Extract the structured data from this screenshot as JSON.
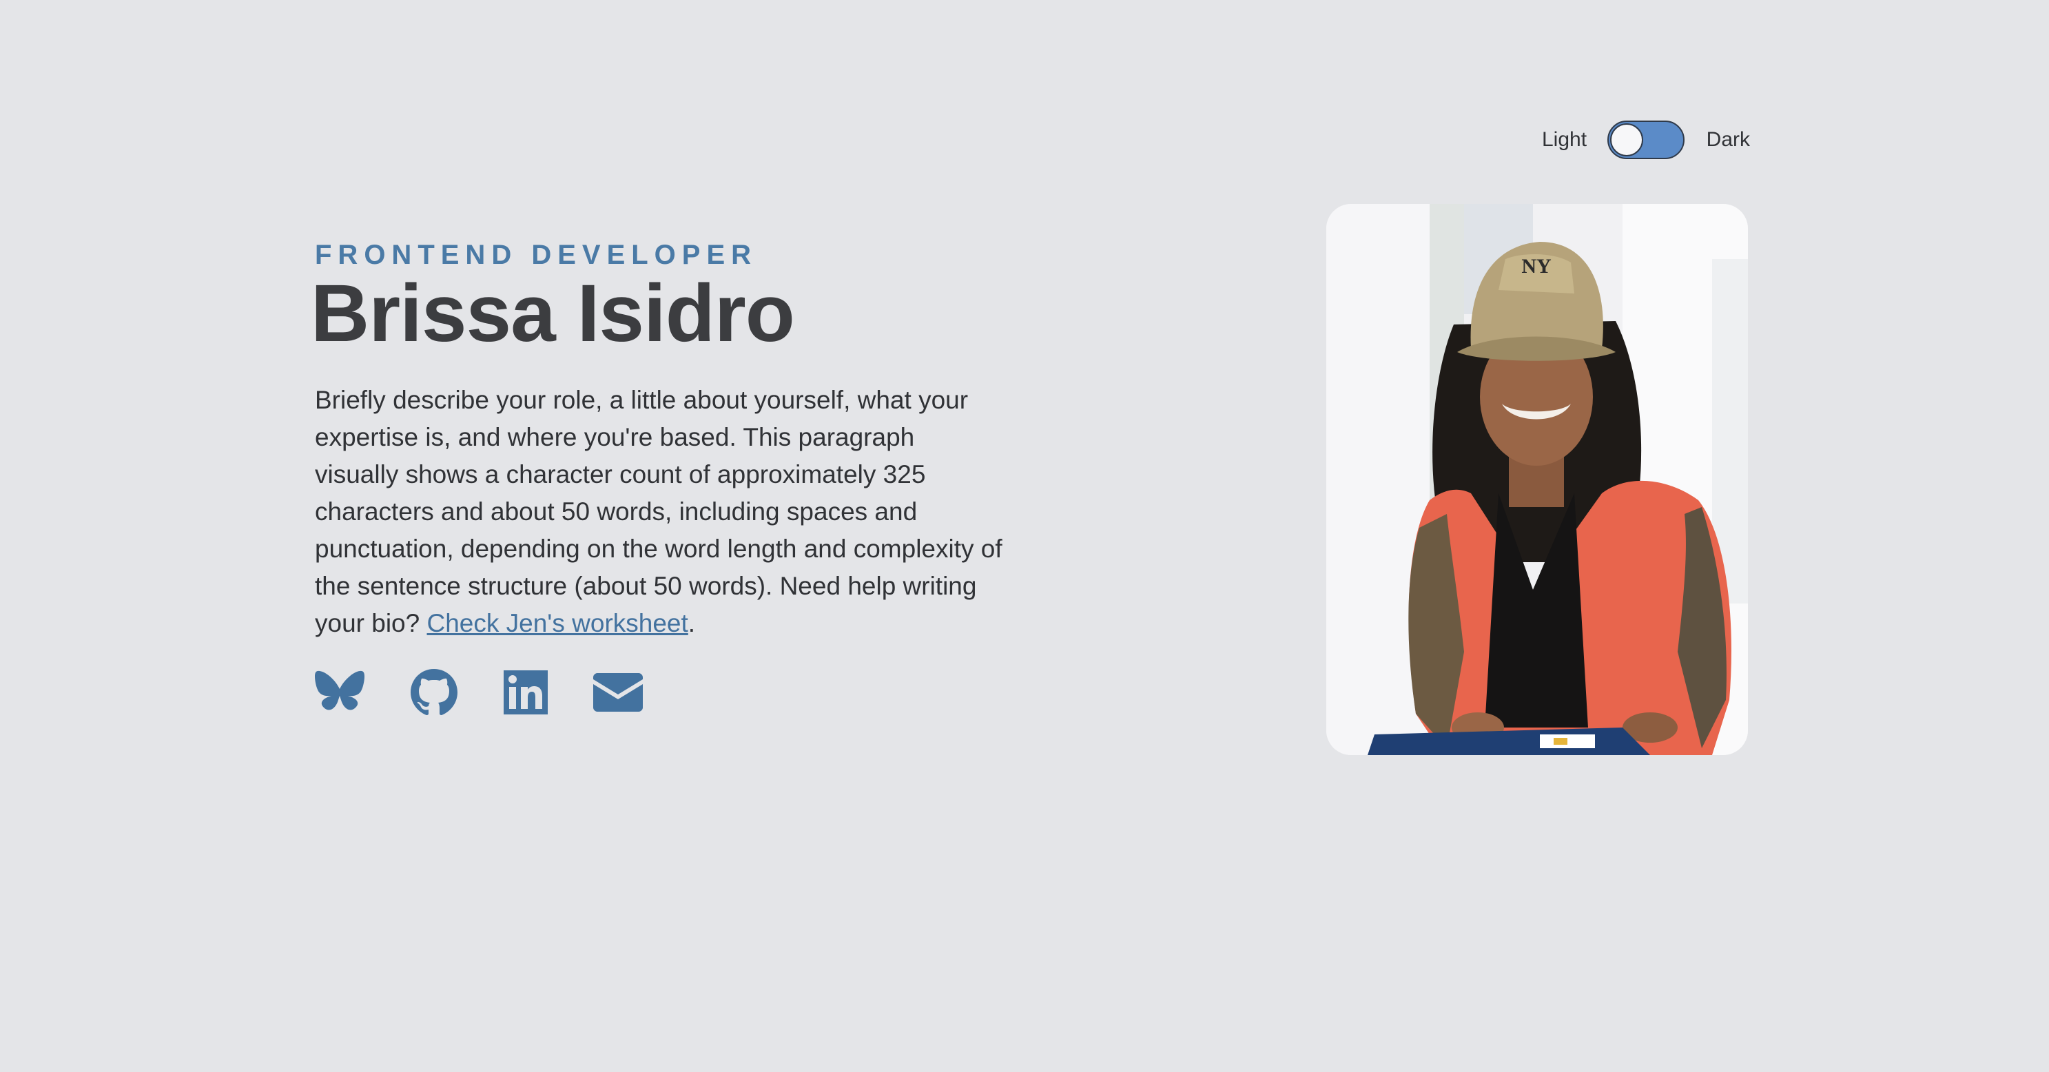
{
  "theme_toggle": {
    "light_label": "Light",
    "dark_label": "Dark",
    "state": "dark"
  },
  "intro": {
    "role": "FRONTEND DEVELOPER",
    "name": "Brissa Isidro",
    "bio_text": "Briefly describe your role, a little about yourself, what your expertise is, and where you're based. This paragraph visually shows a character count of approximately 325 characters and about 50 words, including spaces and punctuation, depending on the word length and complexity of the sentence structure (about 50 words). Need help writing your bio? ",
    "bio_link": "Check Jen's worksheet",
    "bio_end": "."
  },
  "social": [
    {
      "icon": "bluesky-icon"
    },
    {
      "icon": "github-icon"
    },
    {
      "icon": "linkedin-icon"
    },
    {
      "icon": "email-icon"
    }
  ],
  "colors": {
    "background": "#e4e5e8",
    "accent": "#43729f",
    "text": "#303236",
    "heading": "#3c3d40",
    "toggle_track": "#5b8bc8"
  },
  "portrait": {
    "icon": "profile-photo"
  }
}
